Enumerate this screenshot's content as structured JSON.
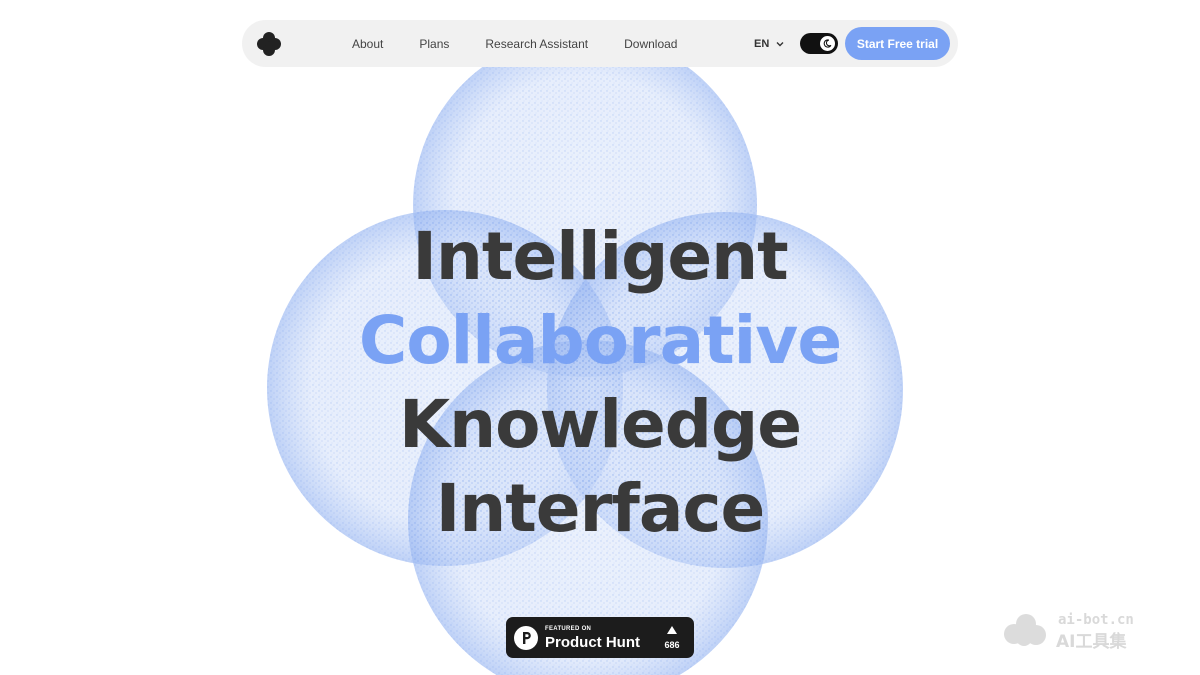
{
  "nav": {
    "links": [
      "About",
      "Plans",
      "Research Assistant",
      "Download"
    ],
    "language": "EN",
    "cta_label": "Start Free trial"
  },
  "hero": {
    "line1": "Intelligent",
    "line2": "Collaborative",
    "line3": "Knowledge",
    "line4": "Interface"
  },
  "badge": {
    "featured": "FEATURED ON",
    "name": "Product Hunt",
    "votes": "686"
  },
  "watermark": {
    "domain": "ai-bot.cn",
    "title": "AI工具集"
  },
  "colors": {
    "accent": "#7aa2f4",
    "text": "#3a3a3a",
    "nav_bg": "#f1f1f1"
  },
  "icons": {
    "logo": "clover-logo-icon",
    "language": "chevron-down-icon",
    "theme": "moon-icon",
    "badge": "product-hunt-icon",
    "upvote": "upvote-triangle-icon"
  }
}
